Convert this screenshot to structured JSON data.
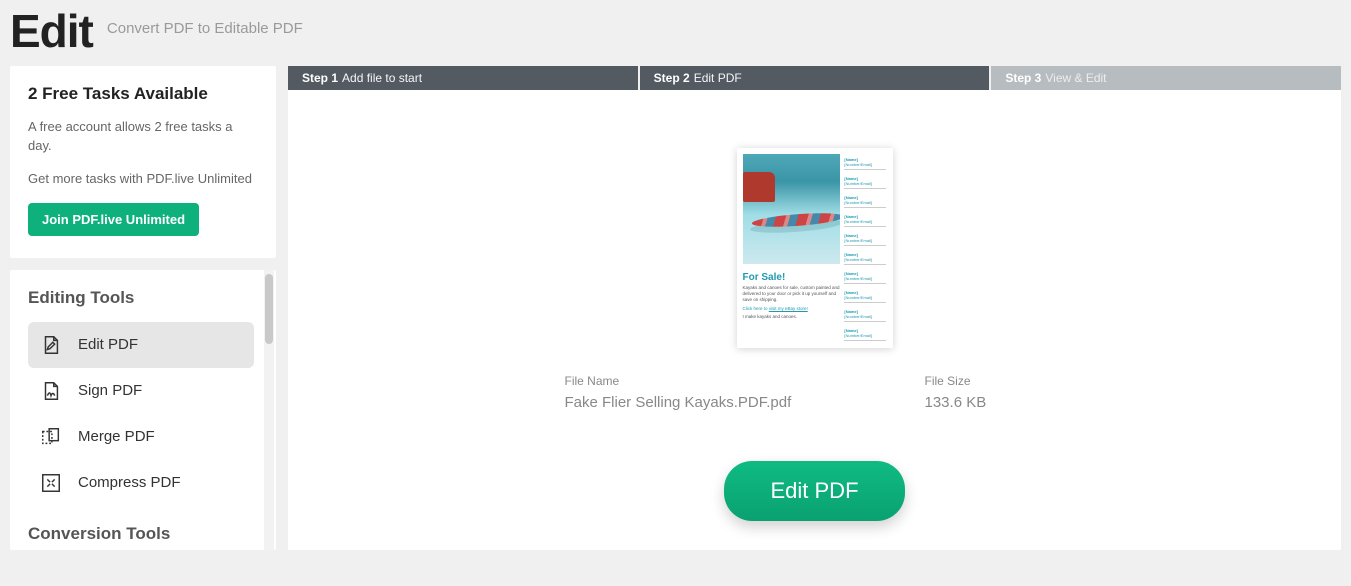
{
  "header": {
    "title": "Edit",
    "subtitle": "Convert PDF to Editable PDF"
  },
  "promo": {
    "title": "2 Free Tasks Available",
    "line1": "A free account allows 2 free tasks a day.",
    "line2": "Get more tasks with PDF.live Unlimited",
    "cta": "Join PDF.live Unlimited"
  },
  "sidebar": {
    "section1_title": "Editing Tools",
    "section2_title": "Conversion Tools",
    "tools": [
      {
        "label": "Edit PDF",
        "active": true
      },
      {
        "label": "Sign PDF",
        "active": false
      },
      {
        "label": "Merge PDF",
        "active": false
      },
      {
        "label": "Compress PDF",
        "active": false
      }
    ]
  },
  "steps": [
    {
      "bold": "Step 1",
      "text": "Add file to start",
      "tone": "dark"
    },
    {
      "bold": "Step 2",
      "text": "Edit PDF",
      "tone": "dark"
    },
    {
      "bold": "Step 3",
      "text": "View & Edit",
      "tone": "light"
    }
  ],
  "thumbnail": {
    "headline": "For Sale!",
    "desc": "Kayaks and canoes for sale, custom painted and delivered to your door or pick it up yourself and save on shipping.",
    "link_prefix": "Click here to ",
    "link_text": "visit my eBay store!",
    "footer": "I make kayaks and canoes.",
    "tear_text1": "[Name]",
    "tear_text2": "[Number/Email]",
    "tear_count": 10
  },
  "file": {
    "name_label": "File Name",
    "name_value": "Fake Flier Selling Kayaks.PDF.pdf",
    "size_label": "File Size",
    "size_value": "133.6 KB"
  },
  "action": {
    "primary": "Edit PDF"
  }
}
